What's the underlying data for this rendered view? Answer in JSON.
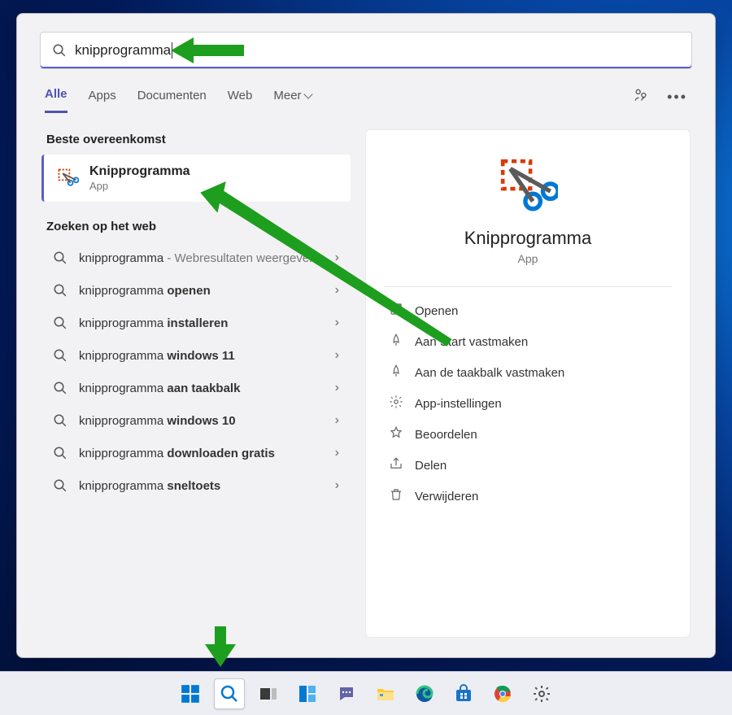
{
  "search": {
    "query": "knipprogramma"
  },
  "tabs": {
    "items": [
      "Alle",
      "Apps",
      "Documenten",
      "Web",
      "Meer"
    ],
    "active_index": 0
  },
  "best_match": {
    "section_title": "Beste overeenkomst",
    "title": "Knipprogramma",
    "subtitle": "App"
  },
  "web_search": {
    "section_title": "Zoeken op het web",
    "items": [
      {
        "prefix": "knipprogramma",
        "bold": "",
        "hint": " - Webresultaten weergeven"
      },
      {
        "prefix": "knipprogramma ",
        "bold": "openen",
        "hint": ""
      },
      {
        "prefix": "knipprogramma ",
        "bold": "installeren",
        "hint": ""
      },
      {
        "prefix": "knipprogramma ",
        "bold": "windows 11",
        "hint": ""
      },
      {
        "prefix": "knipprogramma ",
        "bold": "aan taakbalk",
        "hint": ""
      },
      {
        "prefix": "knipprogramma ",
        "bold": "windows 10",
        "hint": ""
      },
      {
        "prefix": "knipprogramma ",
        "bold": "downloaden gratis",
        "hint": ""
      },
      {
        "prefix": "knipprogramma ",
        "bold": "sneltoets",
        "hint": ""
      }
    ]
  },
  "detail": {
    "title": "Knipprogramma",
    "kind": "App",
    "actions": [
      {
        "icon": "open-icon",
        "label": "Openen"
      },
      {
        "icon": "pin-start-icon",
        "label": "Aan Start vastmaken"
      },
      {
        "icon": "pin-taskbar-icon",
        "label": "Aan de taakbalk vastmaken"
      },
      {
        "icon": "settings-icon",
        "label": "App-instellingen"
      },
      {
        "icon": "star-icon",
        "label": "Beoordelen"
      },
      {
        "icon": "share-icon",
        "label": "Delen"
      },
      {
        "icon": "trash-icon",
        "label": "Verwijderen"
      }
    ]
  },
  "taskbar": {
    "items": [
      "start-icon",
      "search-icon",
      "task-view-icon",
      "widgets-icon",
      "chat-icon",
      "explorer-icon",
      "edge-icon",
      "store-icon",
      "chrome-icon",
      "system-settings-icon"
    ],
    "active_index": 1
  }
}
